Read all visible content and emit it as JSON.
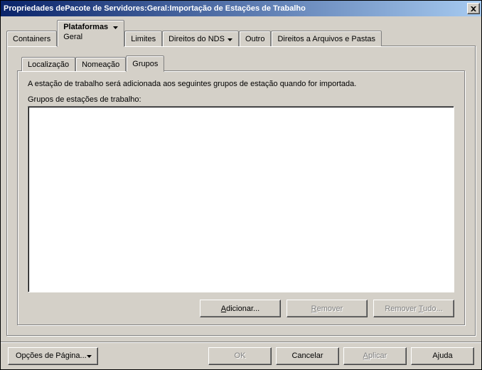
{
  "title": "Propriedades dePacote de Servidores:Geral:Importação de Estações de Trabalho",
  "top_tabs": {
    "containers": "Containers",
    "plataformas": "Plataformas",
    "plataformas_sub": "Geral",
    "limites": "Limites",
    "direitos_nds": "Direitos do NDS",
    "outro": "Outro",
    "direitos_arquivos": "Direitos a Arquivos e Pastas"
  },
  "inner_tabs": {
    "localizacao": "Localização",
    "nomeacao": "Nomeação",
    "grupos": "Grupos"
  },
  "panel": {
    "description": "A estação de trabalho será adicionada aos seguintes grupos de estação quando for importada.",
    "list_label": "Grupos de estações de trabalho:"
  },
  "buttons": {
    "adicionar": "Adicionar...",
    "remover": "Remover",
    "remover_tudo": "Remover Tudo..."
  },
  "footer": {
    "page_options": "Opções de Página...",
    "ok": "OK",
    "cancelar": "Cancelar",
    "aplicar": "Aplicar",
    "ajuda": "Ajuda"
  }
}
